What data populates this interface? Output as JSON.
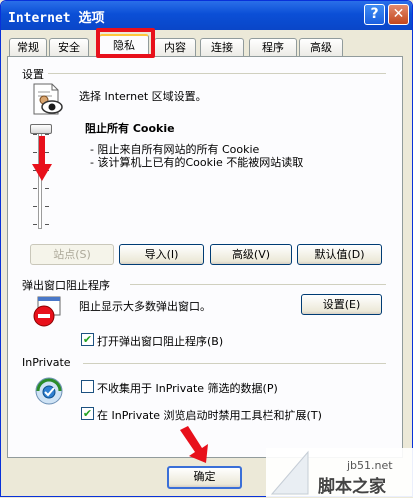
{
  "window": {
    "title": "Internet 选项",
    "help_glyph": "?",
    "close_glyph": "✕"
  },
  "tabs": [
    "常规",
    "安全",
    "隐私",
    "内容",
    "连接",
    "程序",
    "高级"
  ],
  "active_tab": "隐私",
  "settings": {
    "group_label": "设置",
    "description": "选择 Internet 区域设置。",
    "level_title": "阻止所有 Cookie",
    "level_bullets": [
      "- 阻止来自所有网站的所有 Cookie",
      "- 该计算机上已有的Cookie 不能被网站读取"
    ],
    "buttons": {
      "sites": "站点(S)",
      "import": "导入(I)",
      "advanced": "高级(V)",
      "default": "默认值(D)"
    }
  },
  "popup": {
    "group_label": "弹出窗口阻止程序",
    "description": "阻止显示大多数弹出窗口。",
    "settings_button": "设置(E)",
    "enable_checkbox": {
      "label": "打开弹出窗口阻止程序(B)",
      "checked": true
    }
  },
  "inprivate": {
    "group_label": "InPrivate",
    "checkbox_filter": {
      "label": "不收集用于 InPrivate 筛选的数据(P)",
      "checked": false
    },
    "checkbox_toolbars": {
      "label": "在 InPrivate 浏览启动时禁用工具栏和扩展(T)",
      "checked": true
    }
  },
  "footer": {
    "ok_label": "确定"
  },
  "watermark": {
    "site": "jb51.net",
    "name": "脚本之家"
  },
  "colors": {
    "annotation_red": "#e8101b",
    "titlebar_blue": "#0b4fd6",
    "check_green": "#21a121"
  }
}
